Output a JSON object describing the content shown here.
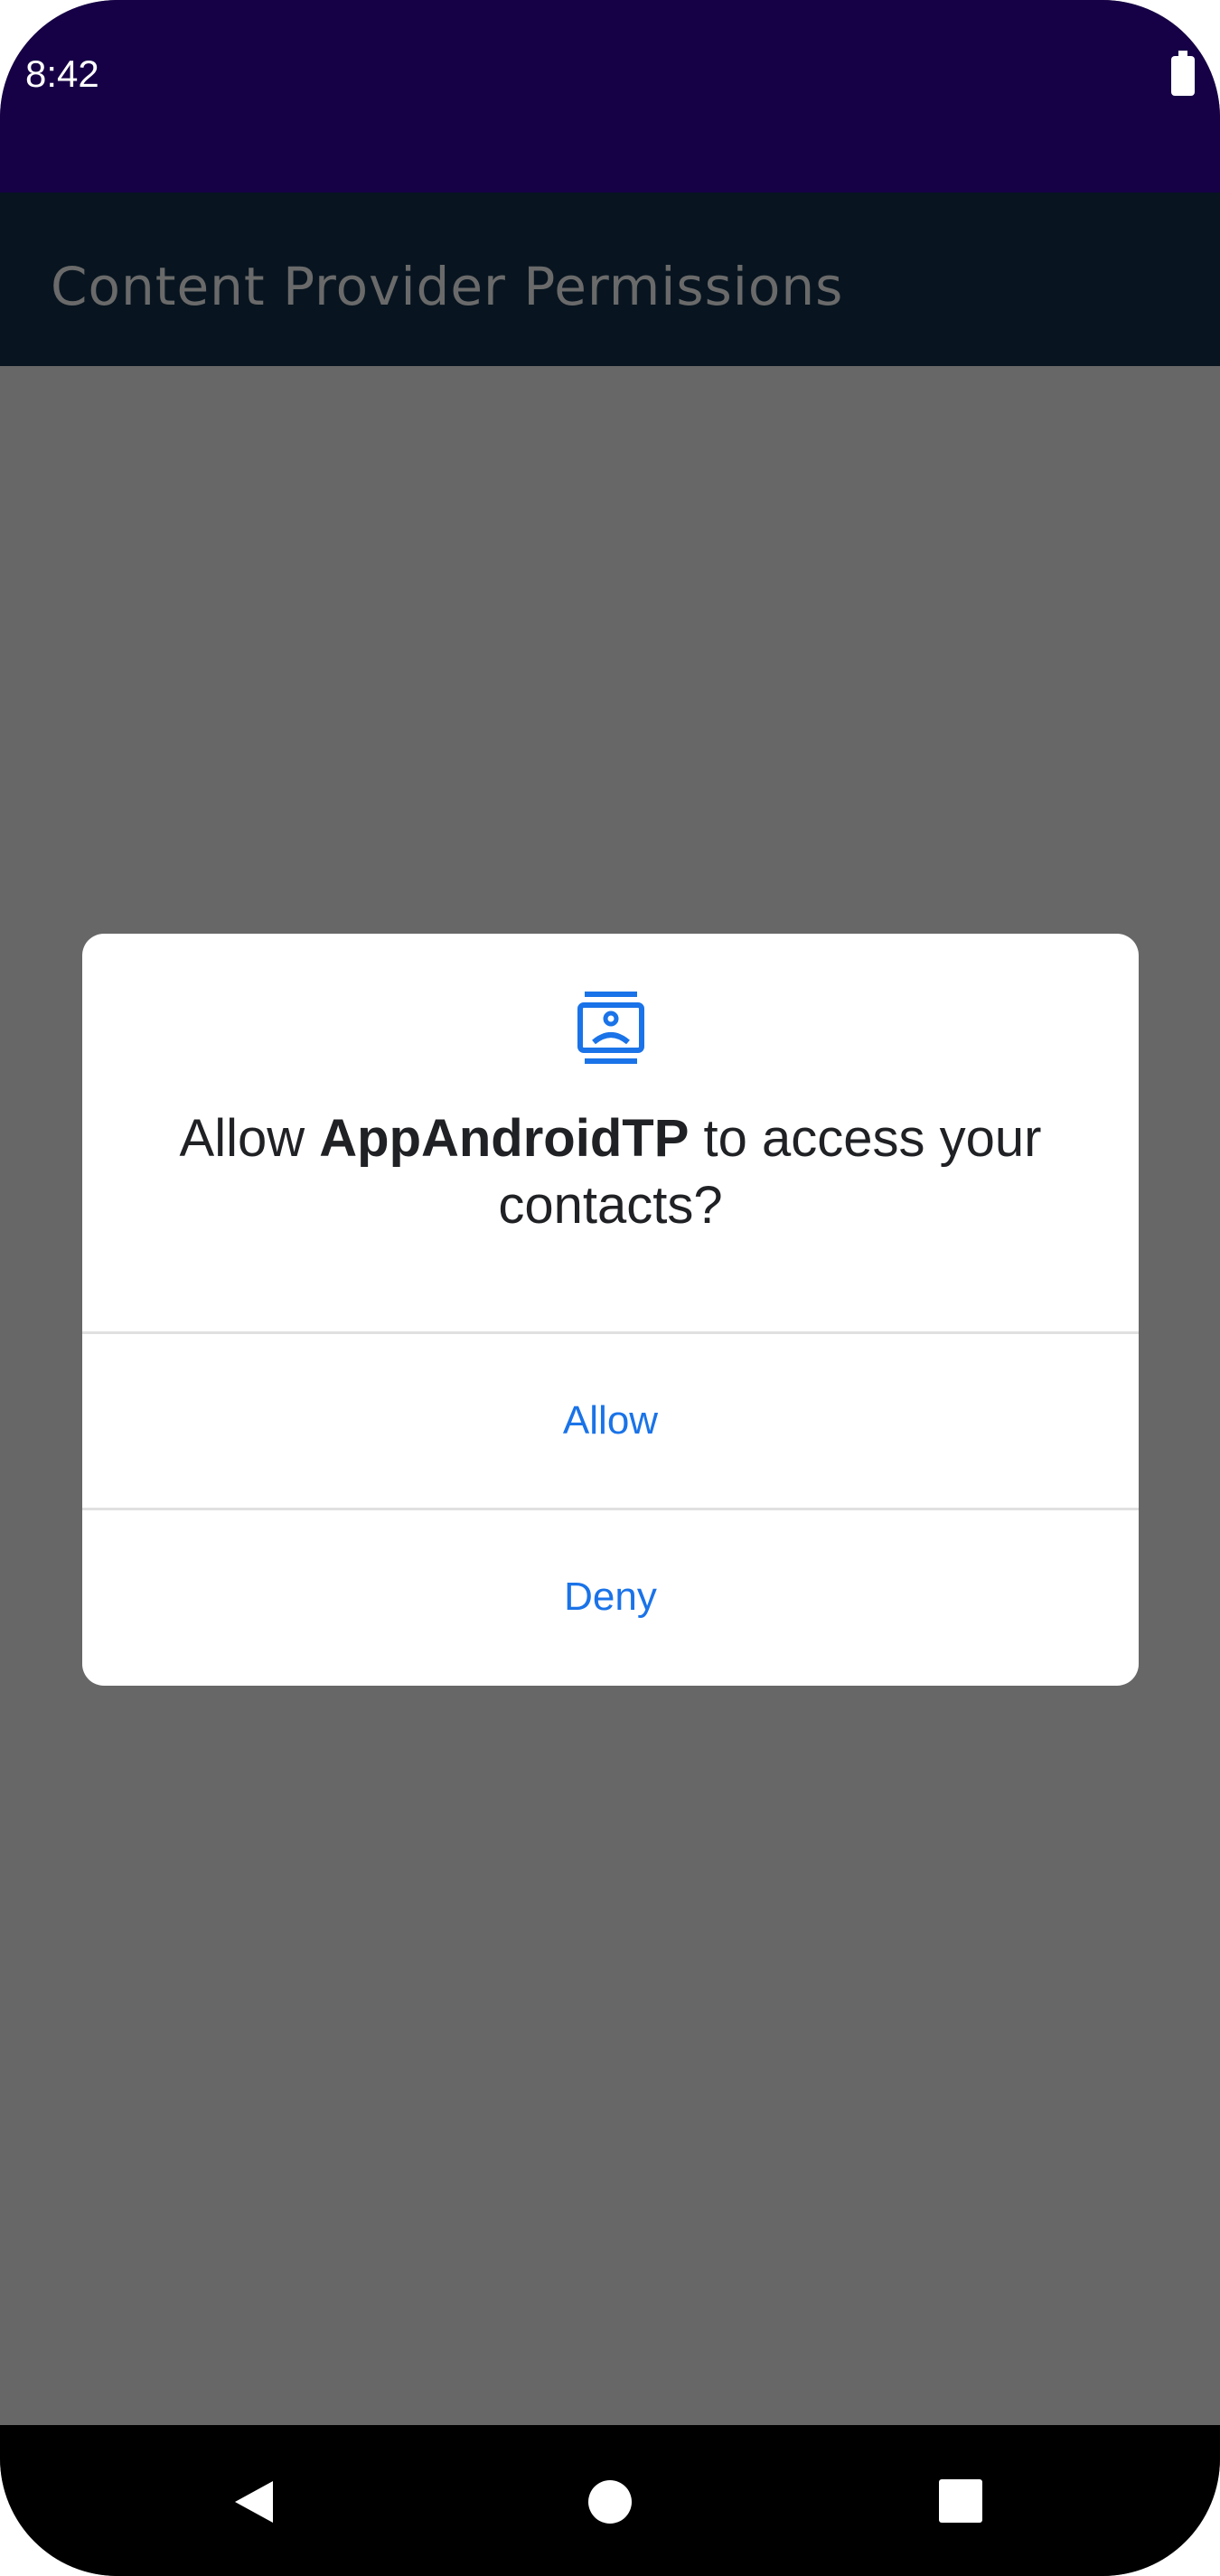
{
  "status_bar": {
    "time": "8:42",
    "battery_icon": "battery-full-icon"
  },
  "app_bar": {
    "title": "Content Provider Permissions"
  },
  "dialog": {
    "icon": "contacts-icon",
    "message_prefix": "Allow ",
    "app_name": "AppAndroidTP",
    "message_suffix": " to access your contacts?",
    "allow_label": "Allow",
    "deny_label": "Deny",
    "accent_color": "#1a73e8"
  },
  "nav_bar": {
    "icons": [
      "back-icon",
      "home-icon",
      "recents-icon"
    ]
  }
}
